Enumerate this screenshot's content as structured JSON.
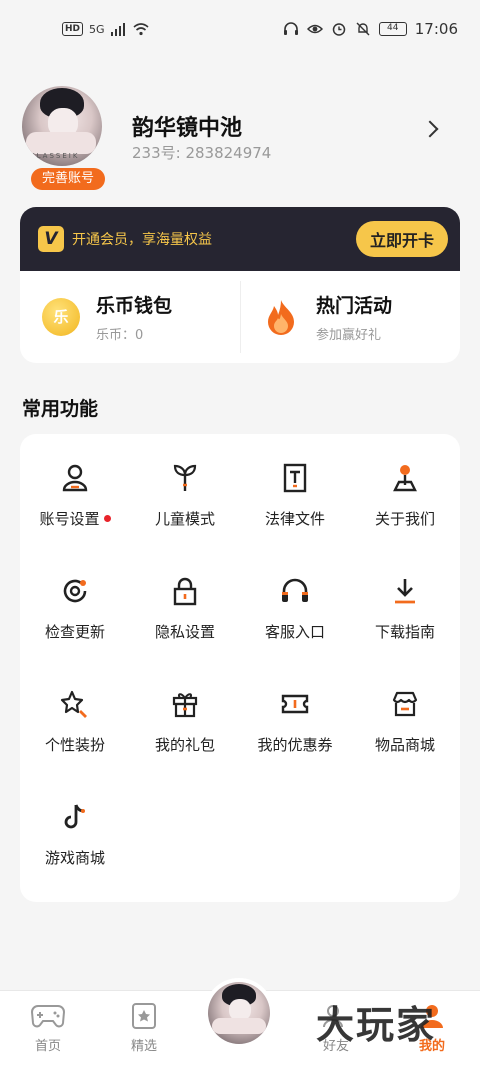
{
  "status_bar": {
    "left": [
      "HD",
      "5G"
    ],
    "battery": "44",
    "time": "17:06"
  },
  "profile": {
    "name": "韵华镜中池",
    "id_text": "233号: 283824974",
    "complete_badge": "完善账号",
    "avatar_watermark": "KLASSEIK"
  },
  "vip": {
    "text": "开通会员，享海量权益",
    "button": "立即开卡",
    "logo": "V"
  },
  "wallet": {
    "title": "乐币钱包",
    "sub": "乐币：0",
    "coin_glyph": "乐"
  },
  "activity": {
    "title": "热门活动",
    "sub": "参加赢好礼"
  },
  "common": {
    "title": "常用功能",
    "items": [
      {
        "label": "账号设置",
        "icon": "user-icon"
      },
      {
        "label": "儿童模式",
        "icon": "sprout-icon"
      },
      {
        "label": "法律文件",
        "icon": "document-icon"
      },
      {
        "label": "关于我们",
        "icon": "location-pin-icon"
      },
      {
        "label": "检查更新",
        "icon": "update-icon"
      },
      {
        "label": "隐私设置",
        "icon": "lock-icon"
      },
      {
        "label": "客服入口",
        "icon": "headset-icon"
      },
      {
        "label": "下载指南",
        "icon": "download-icon"
      },
      {
        "label": "个性装扮",
        "icon": "star-wand-icon"
      },
      {
        "label": "我的礼包",
        "icon": "gift-icon"
      },
      {
        "label": "我的优惠券",
        "icon": "coupon-icon"
      },
      {
        "label": "物品商城",
        "icon": "shop-icon"
      },
      {
        "label": "游戏商城",
        "icon": "tiktok-icon"
      }
    ]
  },
  "nav": {
    "items": [
      {
        "label": "首页",
        "icon": "gamepad-icon"
      },
      {
        "label": "精选",
        "icon": "star-card-icon"
      },
      {
        "label": "好友",
        "icon": "friends-icon"
      },
      {
        "label": "我的",
        "icon": "profile-icon"
      }
    ]
  },
  "watermark": "大玩家",
  "colors": {
    "accent": "#f26b1d",
    "vip_bg": "#262531",
    "vip_gold": "#f6c64a"
  }
}
